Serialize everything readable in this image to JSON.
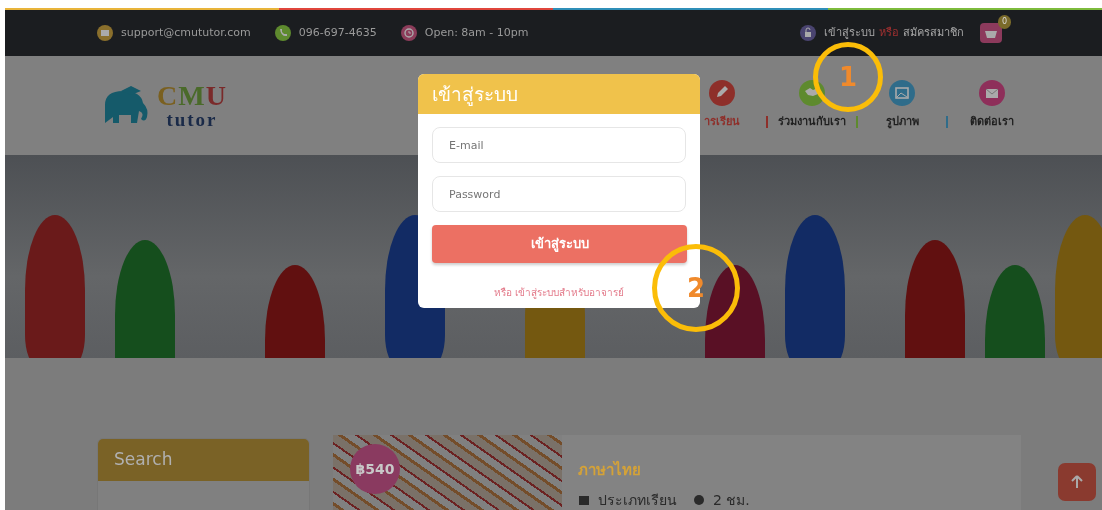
{
  "top_bar": {
    "contacts": [
      {
        "kind": "email",
        "text": "support@cmututor.com",
        "color": "#8a6f2c"
      },
      {
        "kind": "phone",
        "text": "096-697-4635",
        "color": "#5e8a2e"
      },
      {
        "kind": "clock",
        "text": "Open: 8am - 10pm",
        "color": "#8c3c5a"
      }
    ],
    "login": "เข้าสู่ระบบ",
    "or": "หรือ",
    "register": "สมัครสมาชิก",
    "cart_count": "0"
  },
  "logo": {
    "line_1": "CMU",
    "line_2": "tutor"
  },
  "nav": [
    {
      "kind": "pencil",
      "label": "ารเรียน",
      "color": "#8e2f2a",
      "selected": true
    },
    {
      "kind": "handshake",
      "label": "ร่วมงานกับเรา",
      "color": "#5e8a2e",
      "selected": false
    },
    {
      "kind": "picture",
      "label": "รูปภาพ",
      "color": "#2f6c8a",
      "selected": false
    },
    {
      "kind": "envelope",
      "label": "ติดต่อเรา",
      "color": "#8e2f5a",
      "selected": false
    }
  ],
  "login_modal": {
    "title": "เข้าสู่ระบบ",
    "email_placeholder": "E-mail",
    "password_placeholder": "Password",
    "submit": "เข้าสู่ระบบ",
    "alt_link": "หรือ เข้าสู่ระบบสำหรับอาจารย์"
  },
  "sidebar": {
    "search_title": "Search"
  },
  "course": {
    "price": "฿540",
    "title": "ภาษาไทย",
    "meta": [
      "ประเภทเรียน",
      "2 ชม."
    ]
  },
  "annotations": [
    {
      "label": "1"
    },
    {
      "label": "2"
    }
  ]
}
